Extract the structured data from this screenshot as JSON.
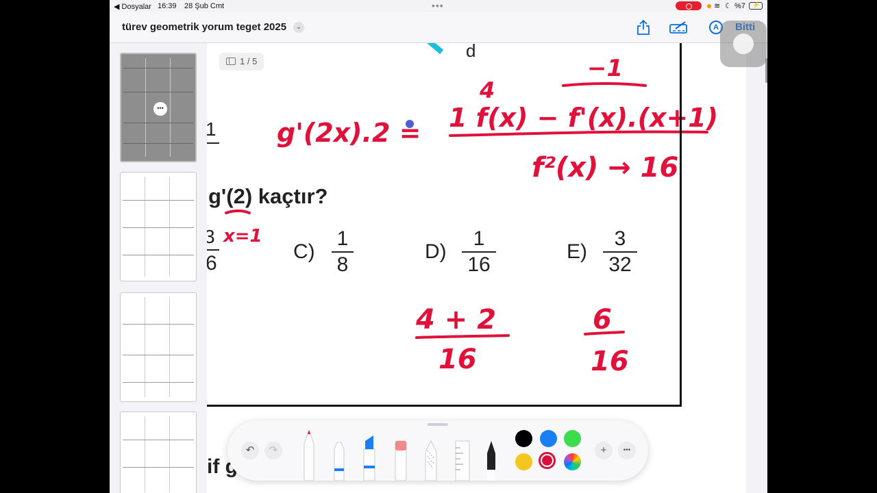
{
  "status_bar": {
    "back_label": "◀ Dosyalar",
    "time": "16:39",
    "date": "28 Şub Cmt",
    "battery": "%7"
  },
  "nav": {
    "title": "türev geometrik yorum teget 2025",
    "done_label": "Bitti",
    "icons": [
      "share-icon",
      "markup-icon",
      "pencil-circle-icon"
    ]
  },
  "document": {
    "page_indicator": "1 / 5",
    "question_text": "g'(2) kaçtır?",
    "partial_fraction_top": "1",
    "partial_fraction_left": "3",
    "partial_fraction_left_den": "6",
    "options": [
      {
        "label": "C)",
        "num": "1",
        "den": "8"
      },
      {
        "label": "D)",
        "num": "1",
        "den": "16"
      },
      {
        "label": "E)",
        "num": "3",
        "den": "32"
      }
    ],
    "top_letter": "d",
    "bottom_partial": "if g",
    "handwriting": {
      "lhs": "g'(2x).2 =",
      "numerator": "1 f(x) − f'(x).(x+1)",
      "numerator_small_above_f": "4",
      "numerator_small_above_fprime": "−1",
      "denominator": "f²(x) → 16",
      "under_question": "x=1",
      "sum_num": "4 + 2",
      "sum_den": "16",
      "result_num": "6",
      "result_den": "16"
    }
  },
  "toolbar": {
    "undo_icon": "undo-icon",
    "redo_icon": "redo-icon",
    "tools": [
      "pen-tool",
      "marker-tool",
      "highlighter-tool",
      "eraser-tool",
      "lasso-tool",
      "ruler-tool",
      "fountain-pen-tool"
    ],
    "colors": [
      "#000000",
      "#1a7ff0",
      "#3ddc4a",
      "#f4c61f",
      "#d8113a",
      "rainbow"
    ],
    "selected_color": "#d8113a"
  },
  "colors": {
    "accent": "#0a6ee0",
    "ink": "#e0113a"
  }
}
